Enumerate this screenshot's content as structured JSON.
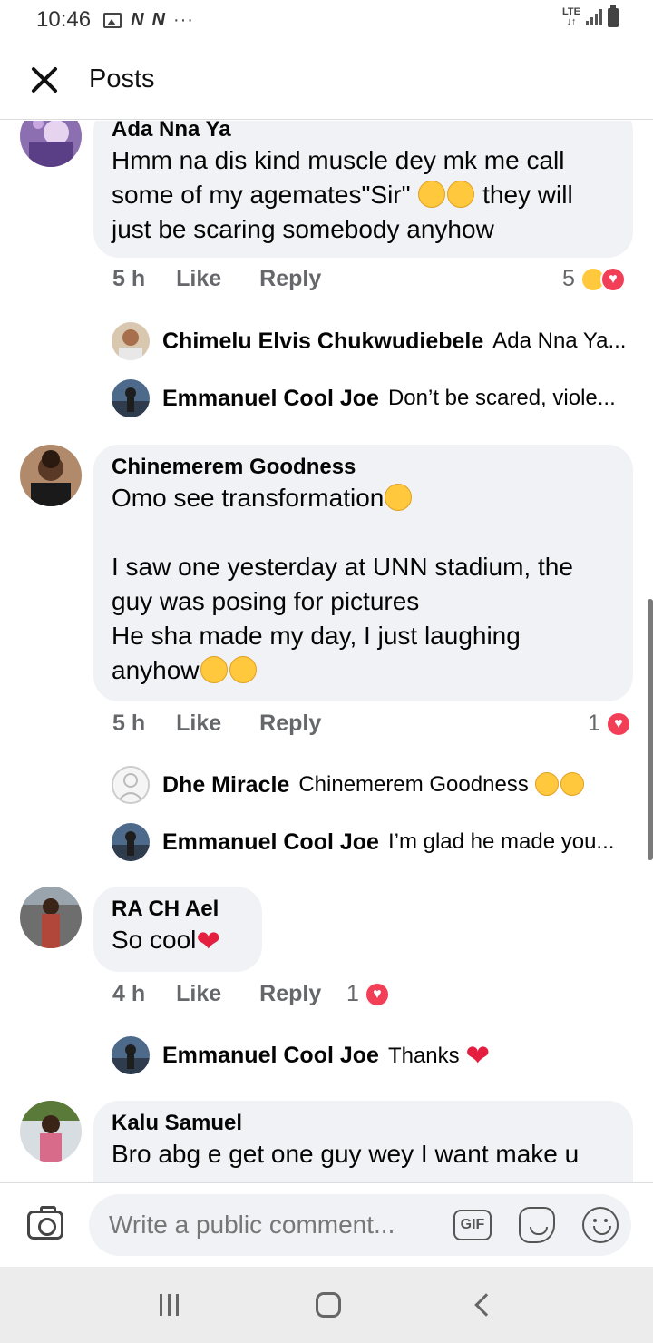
{
  "status_bar": {
    "time": "10:46",
    "network": "LTE",
    "carrier_icons": [
      "N",
      "N"
    ],
    "more": "···"
  },
  "header": {
    "title": "Posts"
  },
  "comments": [
    {
      "author": "Ada Nna Ya",
      "text": "Hmm na dis kind muscle dey mk me call some of my agemates\"Sir\" ",
      "text_after": " they will just be scaring somebody anyhow",
      "time": "5 h",
      "like": "Like",
      "reply": "Reply",
      "reaction_count": "5",
      "replies": [
        {
          "name": "Chimelu Elvis Chukwudiebele",
          "text": "Ada Nna Ya..."
        },
        {
          "name": "Emmanuel Cool Joe",
          "text": "Don’t be scared, viole..."
        }
      ]
    },
    {
      "author": "Chinemerem Goodness",
      "text_line1": "Omo see transformation",
      "text_body": "I saw one yesterday at UNN stadium, the guy was posing for pictures\nHe sha made my day, I just laughing anyhow",
      "time": "5 h",
      "like": "Like",
      "reply": "Reply",
      "reaction_count": "1",
      "replies": [
        {
          "name": "Dhe Miracle",
          "text": "Chinemerem Goodness "
        },
        {
          "name": "Emmanuel Cool Joe",
          "text": "I’m glad he made you..."
        }
      ]
    },
    {
      "author": "RA CH Ael",
      "text": "So cool",
      "time": "4 h",
      "like": "Like",
      "reply": "Reply",
      "reaction_count": "1",
      "replies": [
        {
          "name": "Emmanuel Cool Joe",
          "text": "Thanks "
        }
      ]
    },
    {
      "author": "Kalu Samuel",
      "text": "Bro abg e get one guy wey I want make u"
    }
  ],
  "composer": {
    "placeholder": "Write a public comment...",
    "gif_label": "GIF"
  },
  "colors": {
    "bubble": "#f0f2f5",
    "secondary_text": "#65676b",
    "love": "#f33e58"
  }
}
